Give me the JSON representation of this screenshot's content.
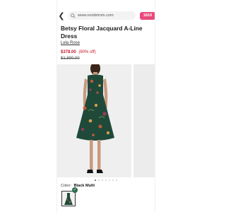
{
  "browser": {
    "url": "www.nordstrom.com",
    "tab_badge": "1810"
  },
  "product": {
    "title": "Betsy Floral Jacquard A-Line Dress",
    "brand": "Lela Rose",
    "sale_price": "$378.00",
    "discount": "(80% off)",
    "original_price": "$1,890.00"
  },
  "gallery": {
    "dot_count": 7,
    "active_index": 0
  },
  "color": {
    "label": "Color:",
    "value": "Black Multi"
  },
  "colors": {
    "accent": "#e84a7a",
    "sale": "#c4162a",
    "dress": "#1f4a3a"
  }
}
